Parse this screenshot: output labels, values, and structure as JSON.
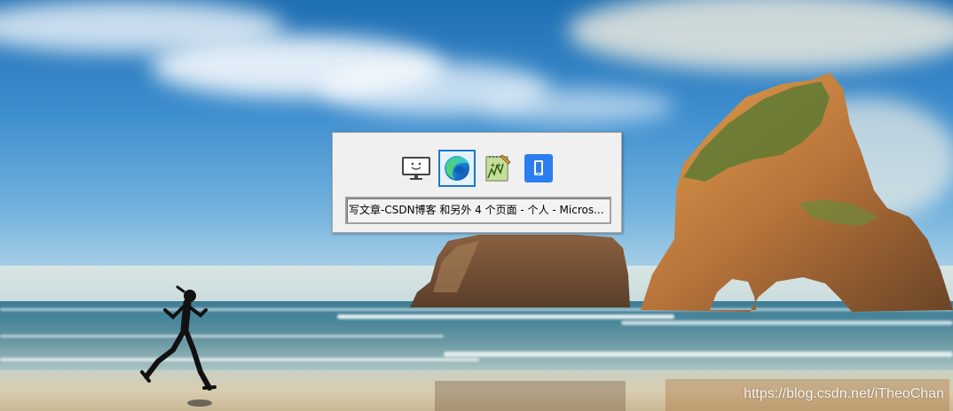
{
  "switcher": {
    "windows": [
      {
        "app": "Desktop",
        "icon": "monitor-smiley-icon"
      },
      {
        "app": "Microsoft Edge",
        "icon": "edge-icon",
        "selected": true
      },
      {
        "app": "Notepad++",
        "icon": "notepad-plus-plus-icon"
      },
      {
        "app": "Phone",
        "icon": "phone-icon"
      }
    ],
    "selected_title": "写文章-CSDN博客 和另外 4 个页面 - 个人 - Micros..."
  },
  "watermark": "https://blog.csdn.net/iTheoChan",
  "colors": {
    "selection_border": "#1979c9",
    "switcher_bg": "#f0f0f0",
    "phone_icon_blue": "#2b7df0"
  }
}
